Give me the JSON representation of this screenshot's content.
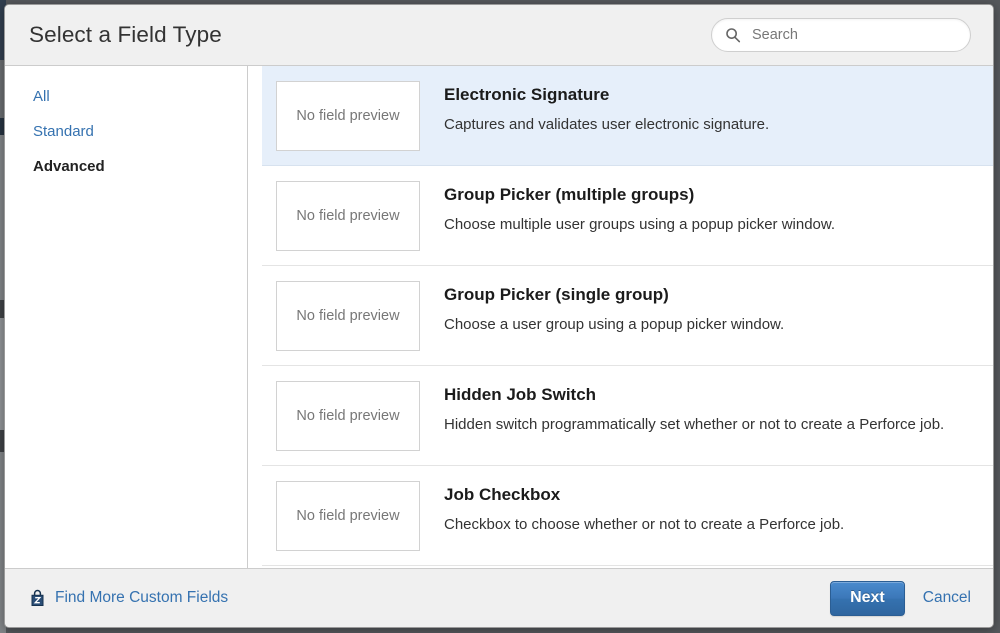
{
  "dialog": {
    "title": "Select a Field Type"
  },
  "search": {
    "placeholder": "Search",
    "value": "",
    "icon": "search-icon"
  },
  "sidebar": {
    "items": [
      {
        "label": "All",
        "selected": false
      },
      {
        "label": "Standard",
        "selected": false
      },
      {
        "label": "Advanced",
        "selected": true
      }
    ]
  },
  "field_list": {
    "preview_placeholder": "No field preview",
    "items": [
      {
        "name": "Electronic Signature",
        "description": "Captures and validates user electronic signature.",
        "selected": true
      },
      {
        "name": "Group Picker (multiple groups)",
        "description": "Choose multiple user groups using a popup picker window.",
        "selected": false
      },
      {
        "name": "Group Picker (single group)",
        "description": "Choose a user group using a popup picker window.",
        "selected": false
      },
      {
        "name": "Hidden Job Switch",
        "description": "Hidden switch programmatically set whether or not to create a Perforce job.",
        "selected": false
      },
      {
        "name": "Job Checkbox",
        "description": "Checkbox to choose whether or not to create a Perforce job.",
        "selected": false
      }
    ]
  },
  "footer": {
    "find_more_label": "Find More Custom Fields",
    "find_more_icon": "marketplace-bag-icon",
    "next_label": "Next",
    "cancel_label": "Cancel"
  },
  "colors": {
    "link": "#3572b0",
    "primary_button": "#3572b0",
    "selected_row": "#e6effa",
    "header_background": "#f0f0f0"
  }
}
